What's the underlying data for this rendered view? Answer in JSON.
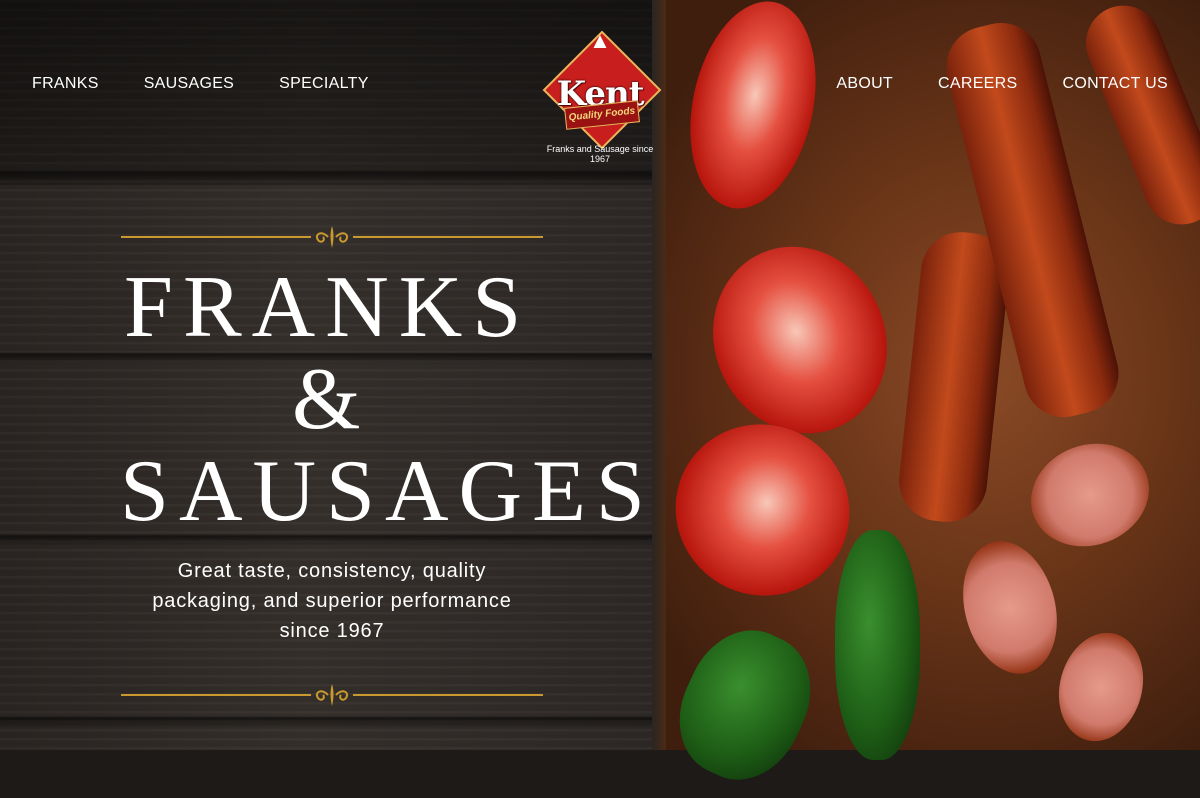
{
  "nav_left": [
    {
      "label": "FRANKS"
    },
    {
      "label": "SAUSAGES"
    },
    {
      "label": "SPECIALTY"
    }
  ],
  "nav_right": [
    {
      "label": "ABOUT"
    },
    {
      "label": "CAREERS"
    },
    {
      "label": "CONTACT US"
    }
  ],
  "logo": {
    "brand": "Kent",
    "ribbon": "Quality Foods",
    "tagline": "Franks and Sausage since 1967",
    "icon": "bull-icon"
  },
  "hero": {
    "line1": "FRANKS",
    "amp": "&",
    "line3": "SAUSAGES",
    "tagline": "Great taste, consistency, quality packaging, and superior performance since 1967"
  },
  "colors": {
    "accent_gold": "#c9982e",
    "logo_red": "#c81e1e",
    "text": "#ffffff"
  }
}
